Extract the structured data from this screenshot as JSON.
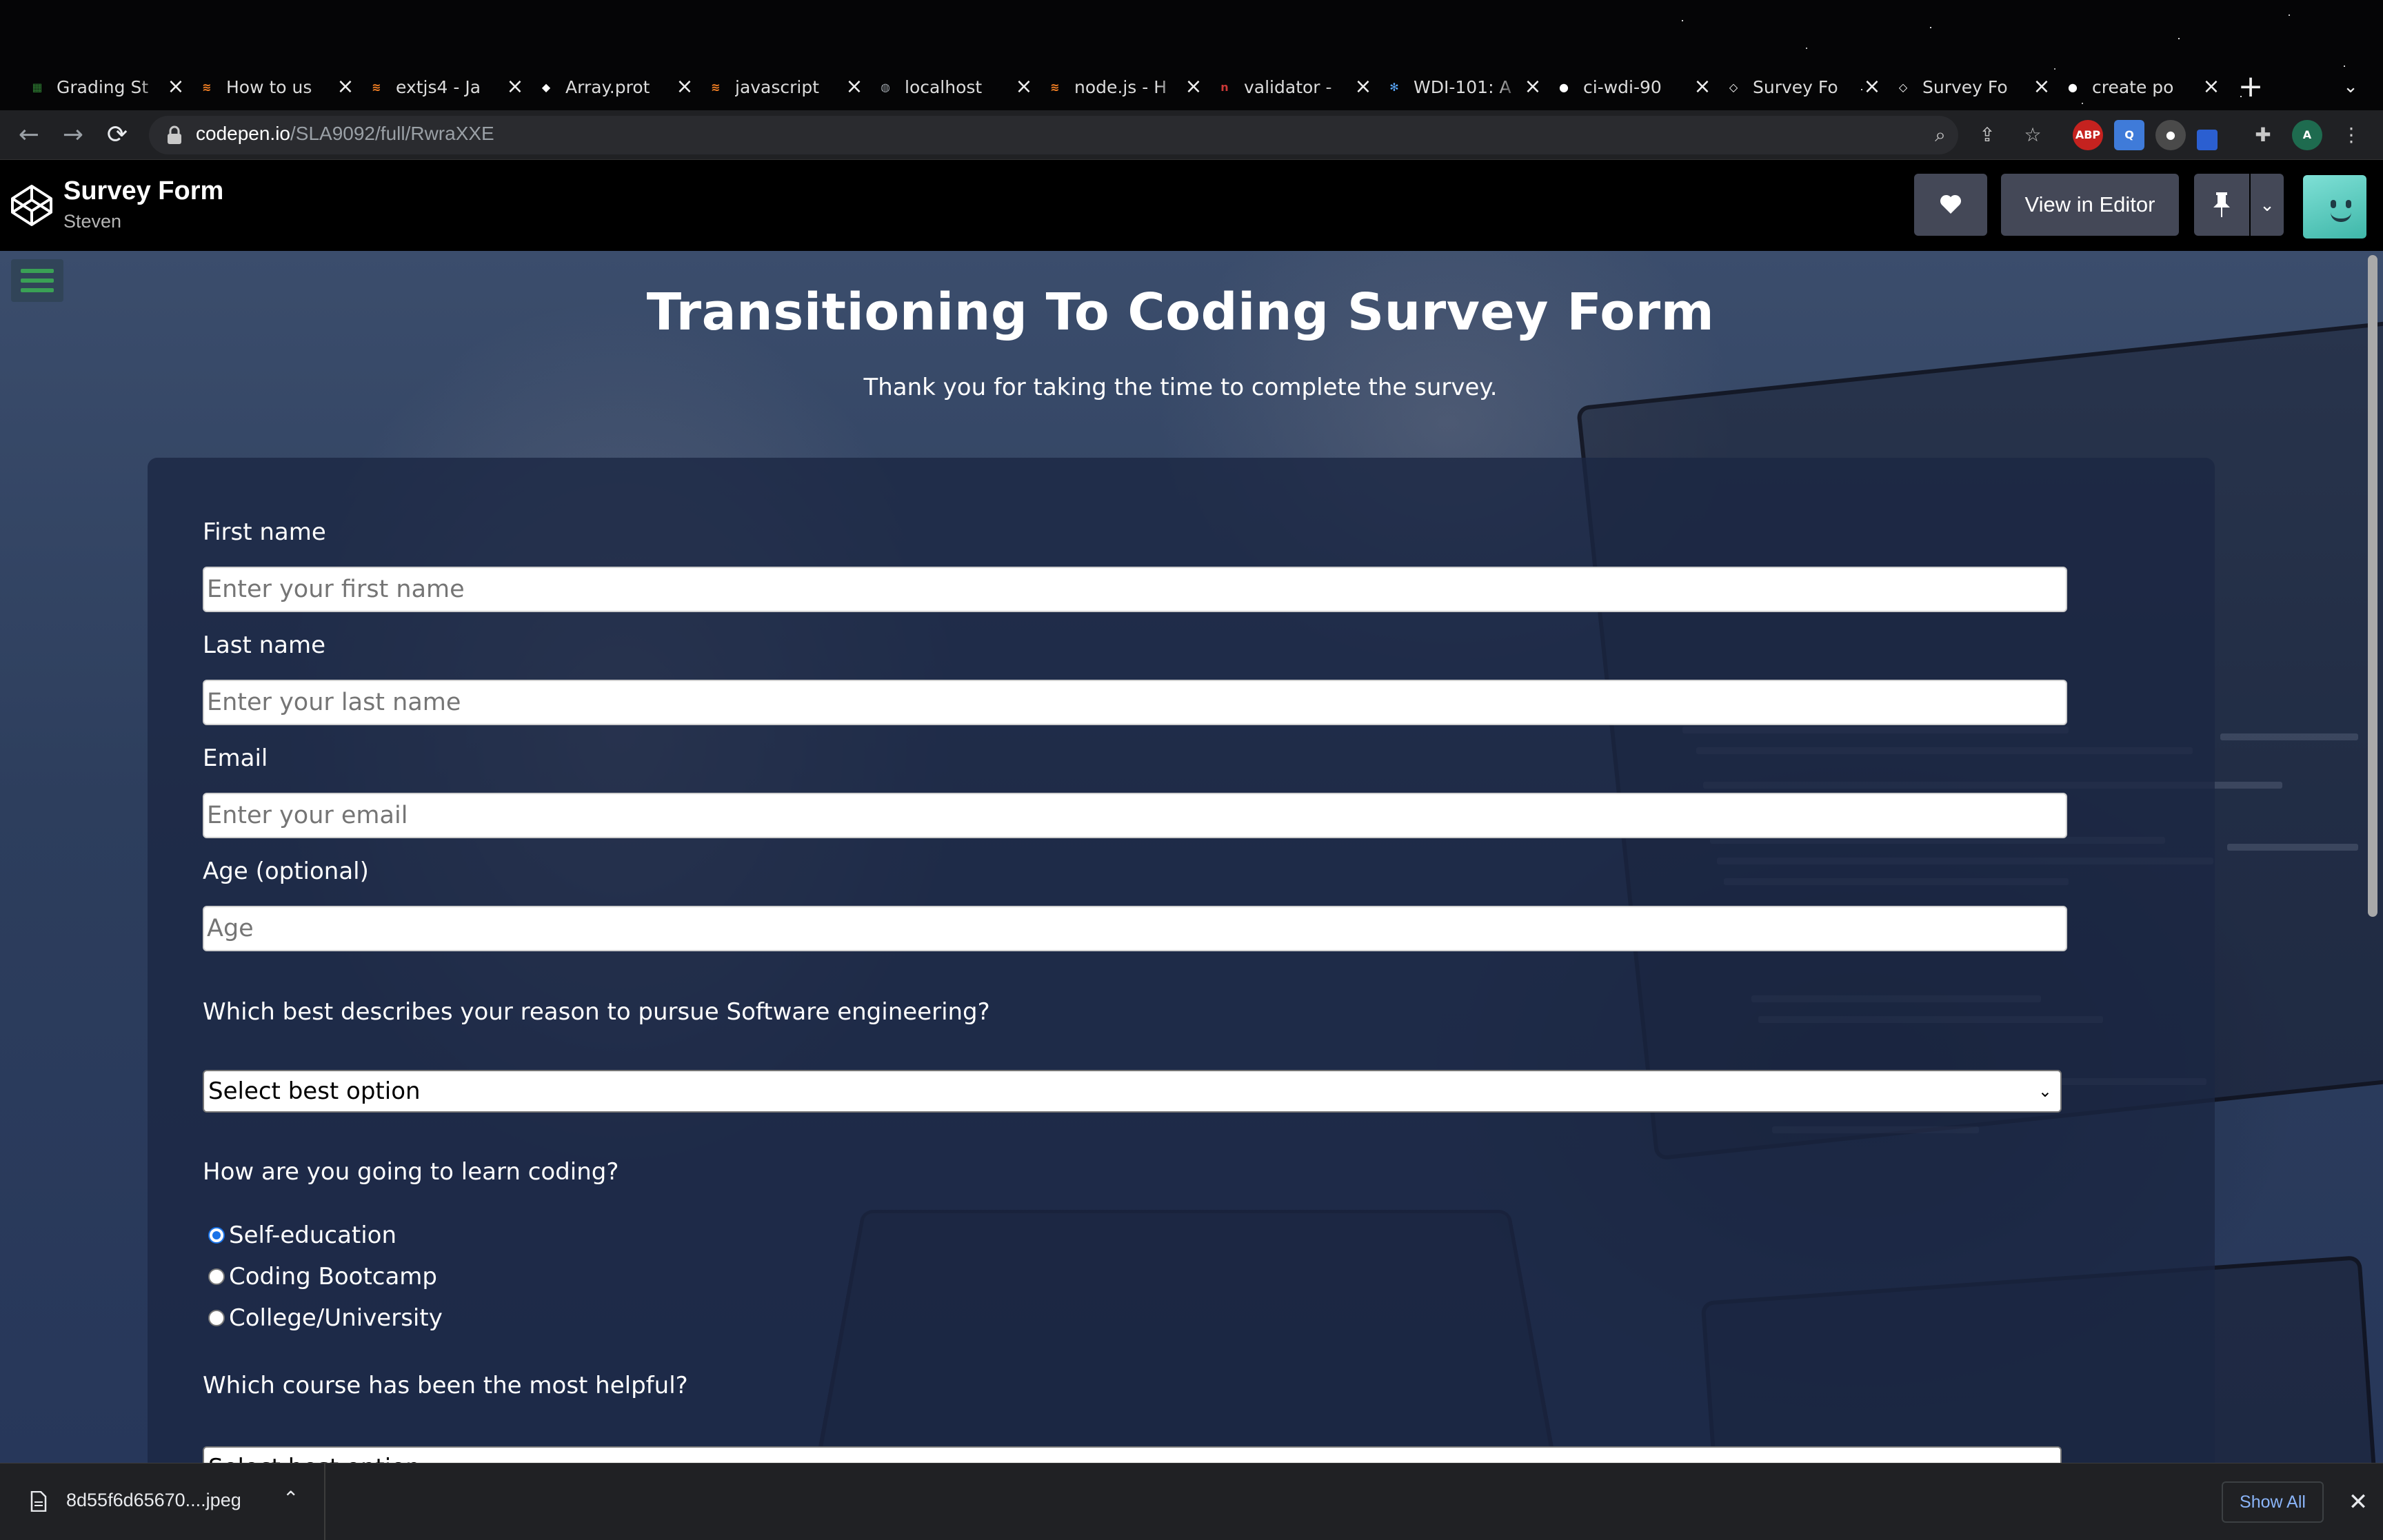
{
  "browser": {
    "tabs": [
      {
        "title": "Grading St",
        "icon": "sheets-icon",
        "color": "#2e7d32"
      },
      {
        "title": "How to us",
        "icon": "stackoverflow-icon",
        "color": "#f48024"
      },
      {
        "title": "extjs4 - Ja",
        "icon": "stackoverflow-icon",
        "color": "#f48024"
      },
      {
        "title": "Array.prot",
        "icon": "mdn-icon",
        "color": "#ffffff"
      },
      {
        "title": "javascript",
        "icon": "stackoverflow-icon",
        "color": "#f48024"
      },
      {
        "title": "localhost",
        "icon": "globe-icon",
        "color": "#9aa0a6"
      },
      {
        "title": "node.js - H",
        "icon": "stackoverflow-icon",
        "color": "#f48024"
      },
      {
        "title": "validator -",
        "icon": "npm-icon",
        "color": "#cb3837"
      },
      {
        "title": "WDI-101: A",
        "icon": "gear-logo-icon",
        "color": "#5aa9ff"
      },
      {
        "title": "ci-wdi-90",
        "icon": "github-icon",
        "color": "#ffffff"
      },
      {
        "title": "Survey Fo",
        "icon": "codepen-icon",
        "color": "#ffffff"
      },
      {
        "title": "Survey Fo",
        "icon": "codepen-icon",
        "color": "#ffffff"
      },
      {
        "title": "create po",
        "icon": "github-icon",
        "color": "#ffffff"
      }
    ],
    "url_host": "codepen.io",
    "url_path": "/SLA9092/full/RwraXXE",
    "profile_initial": "A"
  },
  "codepen": {
    "title": "Survey Form",
    "author": "Steven",
    "view_in_editor": "View in Editor"
  },
  "survey": {
    "title": "Transitioning To Coding Survey Form",
    "description": "Thank you for taking the time to complete the survey.",
    "first_name_label": "First name",
    "first_name_placeholder": "Enter your first name",
    "last_name_label": "Last name",
    "last_name_placeholder": "Enter your last name",
    "email_label": "Email",
    "email_placeholder": "Enter your email",
    "age_label": "Age (optional)",
    "age_placeholder": "Age",
    "reason_question": "Which best describes your reason to pursue Software engineering?",
    "reason_select_value": "Select best option",
    "learn_question": "How are you going to learn coding?",
    "learn_options": [
      "Self-education",
      "Coding Bootcamp",
      "College/University"
    ],
    "learn_selected": "Self-education",
    "course_question": "Which course has been the most helpful?",
    "course_select_value": "Select best option"
  },
  "downloads": {
    "file_name": "8d55f6d65670....jpeg",
    "show_all": "Show All"
  },
  "colors": {
    "accent_green": "#3aa155",
    "link_blue": "#8ab4f8",
    "radio_blue": "#1a73e8"
  }
}
